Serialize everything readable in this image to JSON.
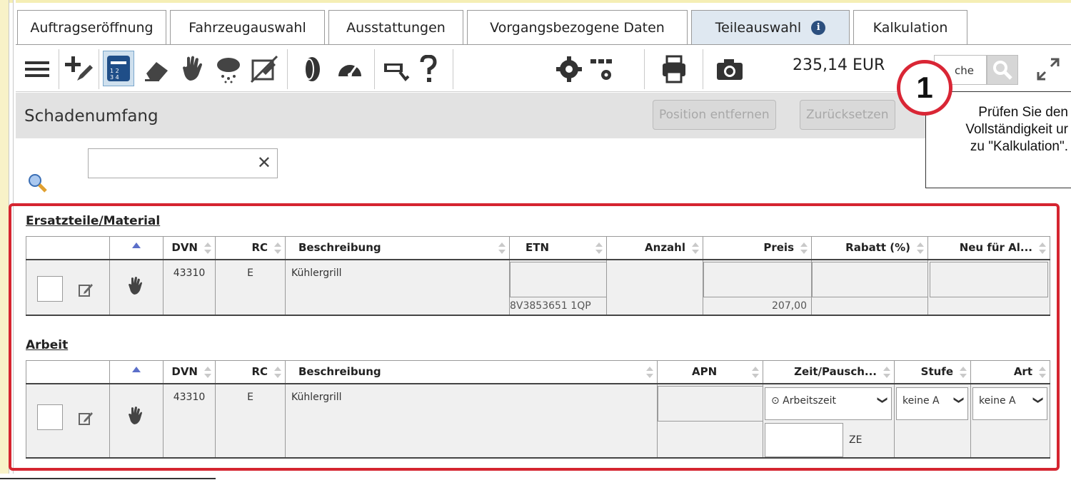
{
  "tabs": [
    {
      "label": "Auftragseröffnung"
    },
    {
      "label": "Fahrzeugauswahl"
    },
    {
      "label": "Ausstattungen"
    },
    {
      "label": "Vorgangsbezogene Daten"
    },
    {
      "label": "Teileauswahl",
      "active": true
    },
    {
      "label": "Kalkulation"
    }
  ],
  "toolbar": {
    "icons": [
      "menu-icon",
      "add-edit-icon",
      "parts-grid-icon",
      "eraser-icon",
      "hand-icon",
      "hail-cloud-icon",
      "no-edit-icon",
      "tire-icon",
      "gauge-icon",
      "spray-gun-icon",
      "question-icon",
      "settings-icon",
      "print-icon",
      "camera-icon",
      "expand-icon"
    ],
    "price": "235,14 EUR",
    "search_placeholder": "che"
  },
  "section": {
    "title": "Schadenumfang",
    "remove_button": "Position entfernen",
    "reset_button": "Zurücksetzen"
  },
  "filter": {
    "clear_symbol": "✕"
  },
  "tooltip": {
    "step": "1",
    "lines": [
      "Prüfen Sie den",
      "Vollständigkeit ur",
      "zu \"Kalkulation\"."
    ]
  },
  "parts_table": {
    "title": "Ersatzteile/Material",
    "headers": {
      "dvn": "DVN",
      "rc": "RC",
      "beschreibung": "Beschreibung",
      "etn": "ETN",
      "anzahl": "Anzahl",
      "preis": "Preis",
      "rabatt": "Rabatt (%)",
      "neu": "Neu für Al..."
    },
    "row": {
      "dvn": "43310",
      "rc": "E",
      "beschreibung": "Kühlergrill",
      "etn": "8V3853651 1QP",
      "preis": "207,00"
    }
  },
  "labor_table": {
    "title": "Arbeit",
    "headers": {
      "dvn": "DVN",
      "rc": "RC",
      "beschreibung": "Beschreibung",
      "apn": "APN",
      "zeit": "Zeit/Pausch...",
      "stufe": "Stufe",
      "art": "Art"
    },
    "row": {
      "dvn": "43310",
      "rc": "E",
      "beschreibung": "Kühlergrill",
      "zeit_select": "⊙ Arbeitszeit",
      "ze_unit": "ZE",
      "stufe_select": "keine A",
      "art_select": "keine A"
    }
  }
}
